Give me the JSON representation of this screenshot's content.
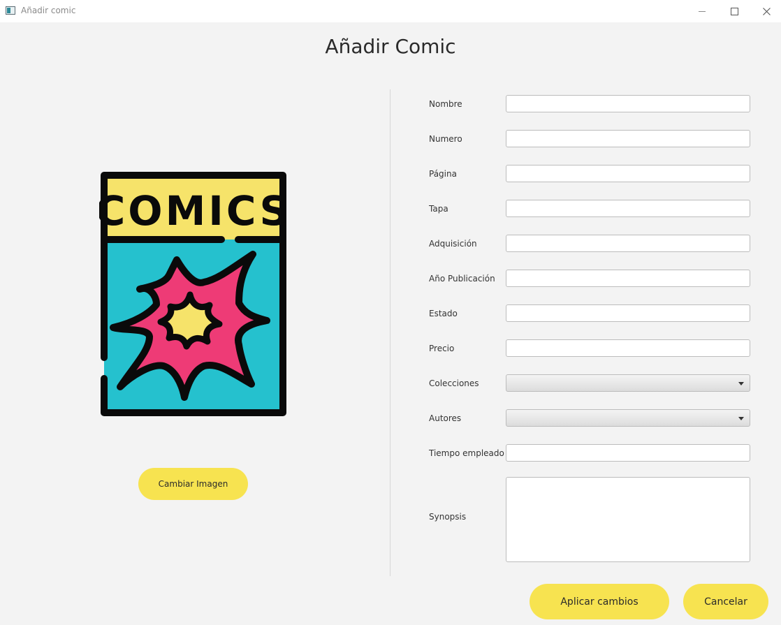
{
  "window": {
    "title": "Añadir comic",
    "controls": {
      "minimize_icon": "minimize-icon",
      "maximize_icon": "maximize-icon",
      "close_icon": "close-icon"
    }
  },
  "page": {
    "heading": "Añadir Comic"
  },
  "cover": {
    "text": "COMICS",
    "icon": "comic-cover-icon"
  },
  "buttons": {
    "change_image": "Cambiar Imagen",
    "apply": "Aplicar cambios",
    "cancel": "Cancelar"
  },
  "form": {
    "nombre": {
      "label": "Nombre",
      "value": ""
    },
    "numero": {
      "label": "Numero",
      "value": ""
    },
    "pagina": {
      "label": "Página",
      "value": ""
    },
    "tapa": {
      "label": "Tapa",
      "value": ""
    },
    "adquisicion": {
      "label": "Adquisición",
      "value": ""
    },
    "anio_publicacion": {
      "label": "Año Publicación",
      "value": ""
    },
    "estado": {
      "label": "Estado",
      "value": ""
    },
    "precio": {
      "label": "Precio",
      "value": ""
    },
    "colecciones": {
      "label": "Colecciones",
      "selected": ""
    },
    "autores": {
      "label": "Autores",
      "selected": ""
    },
    "tiempo_empleado": {
      "label": "Tiempo empleado",
      "value": ""
    },
    "synopsis": {
      "label": "Synopsis",
      "value": ""
    }
  },
  "colors": {
    "accent_yellow": "#f7e350",
    "cover_cyan": "#25c1ce",
    "cover_yellow": "#f6e36a",
    "cover_pink": "#ee3b76",
    "background": "#f3f3f3"
  }
}
